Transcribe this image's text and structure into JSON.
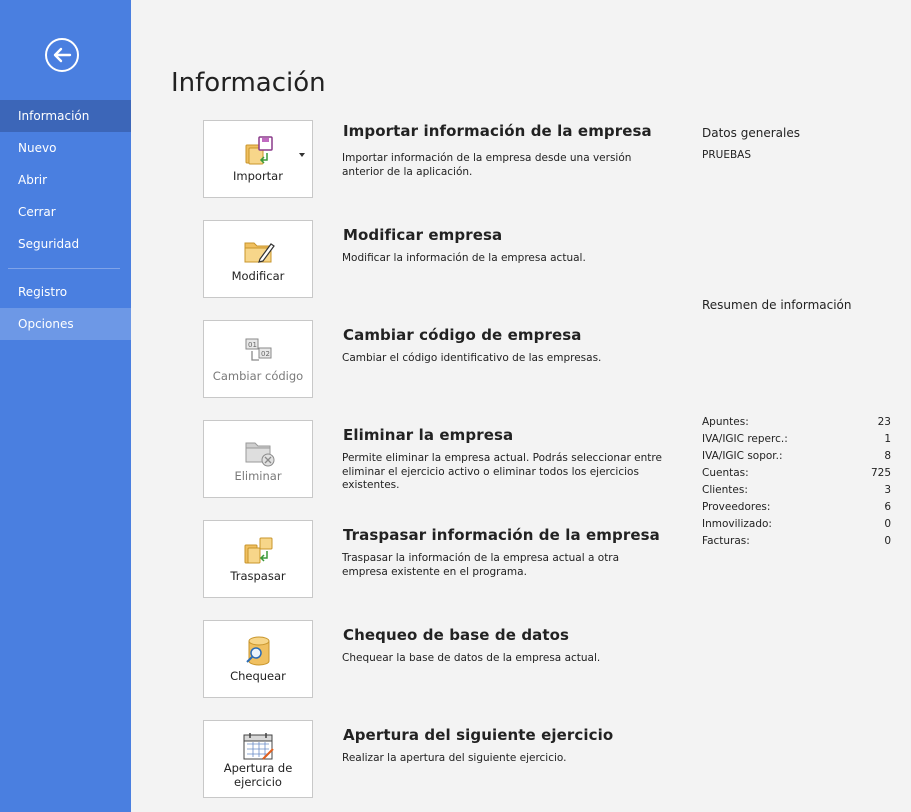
{
  "sidebar": {
    "items": [
      {
        "label": "Información"
      },
      {
        "label": "Nuevo"
      },
      {
        "label": "Abrir"
      },
      {
        "label": "Cerrar"
      },
      {
        "label": "Seguridad"
      },
      {
        "label": "Registro"
      },
      {
        "label": "Opciones"
      }
    ]
  },
  "main": {
    "title": "Información",
    "actions": [
      {
        "tile_label": "Importar",
        "title": "Importar información de la empresa",
        "description": "Importar información de la empresa desde una versión anterior de la aplicación.",
        "icon": "import-icon"
      },
      {
        "tile_label": "Modificar",
        "title": "Modificar empresa",
        "description": "Modificar la información de la empresa actual.",
        "icon": "edit-folder-icon"
      },
      {
        "tile_label": "Cambiar código",
        "title": "Cambiar código de empresa",
        "description": "Cambiar el código identificativo de las empresas.",
        "icon": "change-code-icon"
      },
      {
        "tile_label": "Eliminar",
        "title": "Eliminar la empresa",
        "description": "Permite eliminar la empresa actual. Podrás seleccionar entre eliminar el ejercicio activo o eliminar todos los ejercicios existentes.",
        "icon": "delete-folder-icon"
      },
      {
        "tile_label": "Traspasar",
        "title": "Traspasar información de la empresa",
        "description": "Traspasar la información de la empresa actual a otra empresa existente en el programa.",
        "icon": "transfer-icon"
      },
      {
        "tile_label": "Chequear",
        "title": "Chequeo de base de datos",
        "description": "Chequear la base de datos de la empresa actual.",
        "icon": "database-check-icon"
      },
      {
        "tile_label_line1": "Apertura de",
        "tile_label_line2": "ejercicio",
        "title": "Apertura del siguiente ejercicio",
        "description": "Realizar la apertura del siguiente ejercicio.",
        "icon": "calendar-icon"
      }
    ]
  },
  "info_panel": {
    "general_heading": "Datos generales",
    "company_name": "PRUEBAS",
    "summary_heading": "Resumen de información",
    "stats": [
      {
        "label": "Apuntes:",
        "value": "23"
      },
      {
        "label": "IVA/IGIC reperc.:",
        "value": "1"
      },
      {
        "label": "IVA/IGIC sopor.:",
        "value": "8"
      },
      {
        "label": "Cuentas:",
        "value": "725"
      },
      {
        "label": "Clientes:",
        "value": "3"
      },
      {
        "label": "Proveedores:",
        "value": "6"
      },
      {
        "label": "Inmovilizado:",
        "value": "0"
      },
      {
        "label": "Facturas:",
        "value": "0"
      }
    ]
  },
  "colors": {
    "sidebar_bg": "#4a7fe0",
    "sidebar_active": "#3c66b8",
    "sidebar_hover": "#6d98e6",
    "main_bg": "#f3f3f3"
  }
}
